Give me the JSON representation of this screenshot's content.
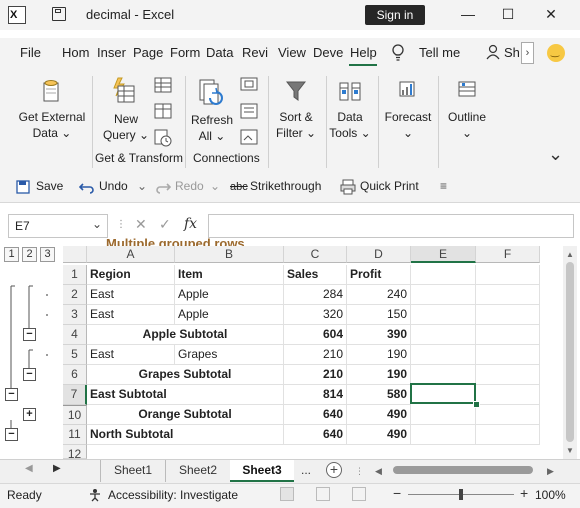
{
  "titlebar": {
    "filename": "decimal",
    "separator": "-",
    "app": "Excel",
    "signin_label": "Sign in",
    "minimize": "—",
    "restore": "☐",
    "close": "✕"
  },
  "tabs": [
    "File",
    "Hom",
    "Inser",
    "Page",
    "Form",
    "Data",
    "Revi",
    "View",
    "Deve",
    "Help"
  ],
  "tellme_label": "Tell me",
  "share_label": "Sh",
  "ribbon": {
    "get_external_data": [
      "Get External",
      "Data ⌄"
    ],
    "new_query": [
      "New",
      "Query ⌄"
    ],
    "refresh_all": [
      "Refresh",
      "All ⌄"
    ],
    "sort_filter": [
      "Sort &",
      "Filter ⌄"
    ],
    "data_tools": [
      "Data",
      "Tools ⌄"
    ],
    "forecast": [
      "Forecast",
      "⌄"
    ],
    "outline": [
      "Outline",
      "⌄"
    ],
    "group_get_transform": "Get & Transform",
    "group_connections": "Connections",
    "collapse": "⌄"
  },
  "qat": {
    "save": "Save",
    "undo": "Undo",
    "redo": "Redo",
    "strike_abc": "abc",
    "strikethrough": "Strikethrough",
    "quick_print": "Quick Print",
    "customize": "≡"
  },
  "formula_bar": {
    "name_box": "E7",
    "cancel": "✕",
    "enter": "✓",
    "fx": "fx",
    "formula": ""
  },
  "annotation": "Multiple grouped rows",
  "outline_levels": [
    "1",
    "2",
    "3"
  ],
  "columns": [
    "A",
    "B",
    "C",
    "D",
    "E",
    "F"
  ],
  "rows": [
    {
      "num": "1",
      "cells": [
        "Region",
        "Item",
        "Sales",
        "Profit"
      ],
      "bold": true,
      "merged": false
    },
    {
      "num": "2",
      "cells": [
        "East",
        "Apple",
        "284",
        "240"
      ],
      "bold": false,
      "merged": false
    },
    {
      "num": "3",
      "cells": [
        "East",
        "Apple",
        "320",
        "150"
      ],
      "bold": false,
      "merged": false
    },
    {
      "num": "4",
      "cells": [
        "Apple Subtotal",
        "",
        "604",
        "390"
      ],
      "bold": true,
      "merged": true
    },
    {
      "num": "5",
      "cells": [
        "East",
        "Grapes",
        "210",
        "190"
      ],
      "bold": false,
      "merged": false
    },
    {
      "num": "6",
      "cells": [
        "Grapes Subtotal",
        "",
        "210",
        "190"
      ],
      "bold": true,
      "merged": true
    },
    {
      "num": "7",
      "cells": [
        "East Subtotal",
        "",
        "814",
        "580"
      ],
      "bold": true,
      "merged": false
    },
    {
      "num": "10",
      "cells": [
        "Orange Subtotal",
        "",
        "640",
        "490"
      ],
      "bold": true,
      "merged": true
    },
    {
      "num": "11",
      "cells": [
        "North Subtotal",
        "",
        "640",
        "490"
      ],
      "bold": true,
      "merged": false
    },
    {
      "num": "12",
      "cells": [
        "",
        "",
        "",
        ""
      ],
      "bold": false,
      "merged": false
    }
  ],
  "outline_buttons": {
    "minus": "−",
    "plus": "+"
  },
  "sheets": {
    "tabs": [
      "Sheet1",
      "Sheet2",
      "Sheet3"
    ],
    "active": "Sheet3",
    "more": "...",
    "add": "+"
  },
  "status": {
    "ready": "Ready",
    "accessibility": "Accessibility: Investigate",
    "zoom": "100%",
    "zoom_level": 1.0,
    "zoom_minus": "−",
    "zoom_plus": "+"
  },
  "colors": {
    "excel_green": "#217346",
    "annotation": "#9c6a2e",
    "active_tab": "#217346"
  }
}
